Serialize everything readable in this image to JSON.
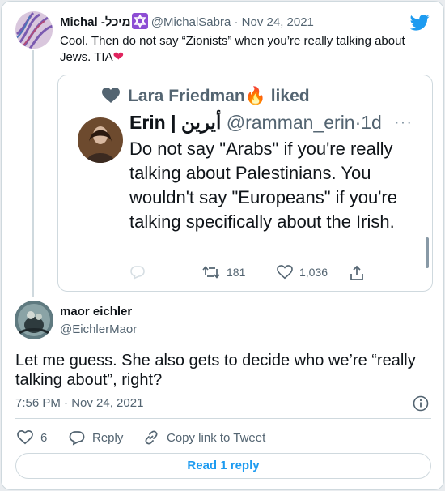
{
  "parent": {
    "name": "Michal -מיכל",
    "name_emoji": "✡",
    "handle": "@MichalSabra",
    "separator": "·",
    "date": "Nov 24, 2021",
    "text": "Cool. Then do not say “Zionists” when you’re really talking about Jews. TIA",
    "text_emoji": "❤"
  },
  "embed": {
    "liked_by": "Lara Friedman",
    "liked_emoji": "🔥",
    "liked_word": "liked",
    "author_name": "Erin | أيرين",
    "author_handle": "@ramman_erin",
    "separator": "·",
    "age": "1d",
    "more": "···",
    "text": "Do not say \"Arabs\" if you're really talking about Palestinians. You wouldn't say \"Europeans\" if you're talking specifically about the Irish.",
    "retweets": "181",
    "likes": "1,036"
  },
  "main": {
    "name": "maor eichler",
    "handle": "@EichlerMaor",
    "text": "Let me guess. She also gets to decide who we’re “really talking about”, right?",
    "timestamp": "7:56 PM · Nov 24, 2021",
    "likes": "6",
    "reply_label": "Reply",
    "copy_label": "Copy link to Tweet",
    "read_replies": "Read 1 reply"
  },
  "colors": {
    "accent": "#1d9bf0",
    "border": "#cfd9de",
    "secondary_text": "#536471",
    "heart": "#e0245e"
  },
  "icons": [
    "twitter-bird-icon",
    "star-of-david-icon",
    "heart-icon",
    "retweet-icon",
    "share-icon",
    "info-icon",
    "reply-icon",
    "link-icon"
  ]
}
